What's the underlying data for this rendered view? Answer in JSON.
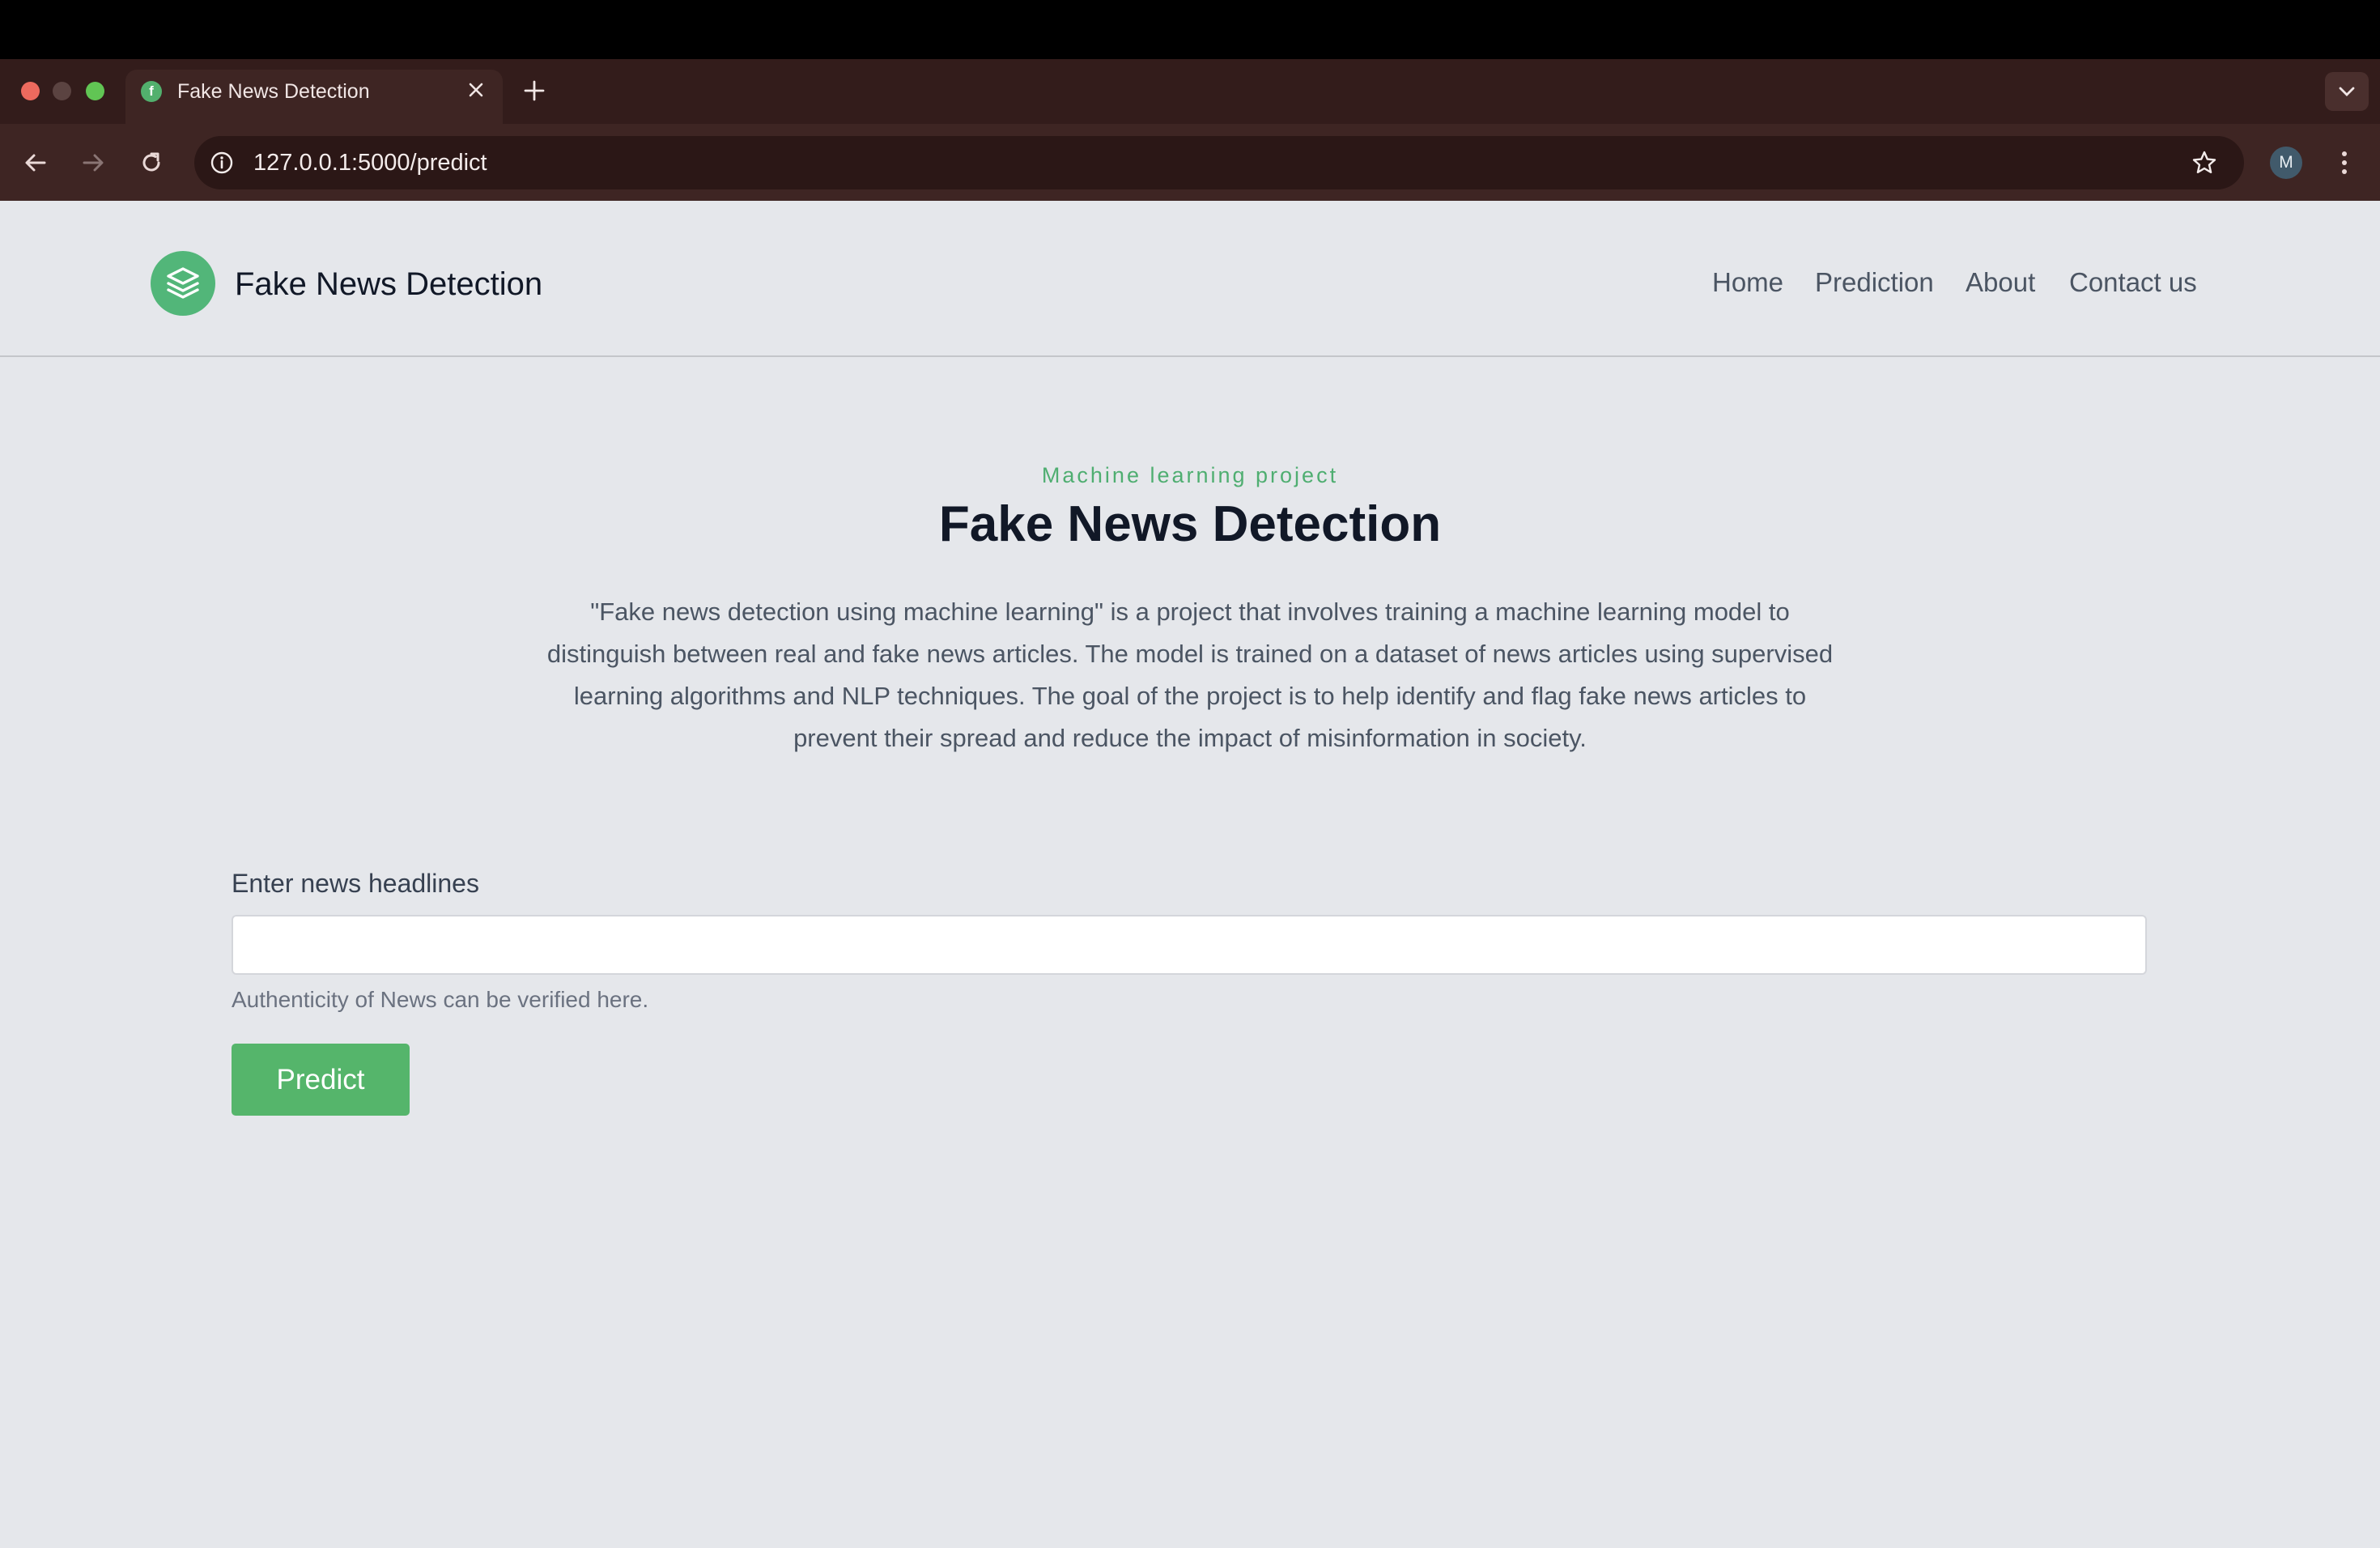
{
  "browser": {
    "tab_title": "Fake News Detection",
    "tab_favicon_glyph": "f",
    "url": "127.0.0.1:5000/predict",
    "profile_initial": "M",
    "icons": [
      "back-icon",
      "forward-icon",
      "reload-icon",
      "site-info-icon",
      "bookmark-star-icon",
      "kebab-menu-icon",
      "tab-search-icon",
      "close-icon",
      "plus-icon"
    ]
  },
  "header": {
    "brand": "Fake News Detection",
    "nav": [
      {
        "label": "Home"
      },
      {
        "label": "Prediction"
      },
      {
        "label": "About"
      },
      {
        "label": "Contact us"
      }
    ]
  },
  "hero": {
    "kicker": "Machine learning project",
    "title": "Fake News Detection",
    "description": "\"Fake news detection using machine learning\" is a project that involves training a machine learning model to distinguish between real and fake news articles. The model is trained on a dataset of news articles using supervised learning algorithms and NLP techniques. The goal of the project is to help identify and flag fake news articles to prevent their spread and reduce the impact of misinformation in society."
  },
  "form": {
    "label": "Enter news headlines",
    "value": "",
    "help": "Authenticity of News can be verified here.",
    "submit_label": "Predict"
  },
  "colors": {
    "accent": "#52b679",
    "button": "#55b56b",
    "page_bg": "#e5e7eb",
    "chrome_bg": "#3e2523"
  }
}
